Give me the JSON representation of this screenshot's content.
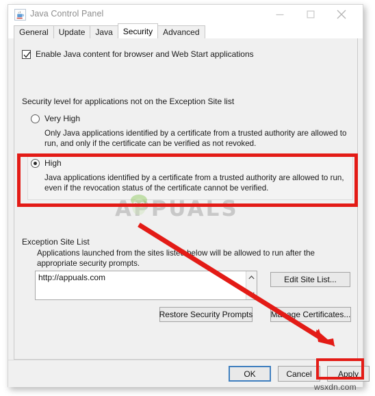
{
  "window": {
    "title": "Java Control Panel",
    "icon": "java-cup-icon",
    "controls": {
      "minimize": "minimize-icon",
      "maximize": "maximize-icon",
      "close": "close-icon"
    }
  },
  "tabs": [
    {
      "label": "General",
      "active": false
    },
    {
      "label": "Update",
      "active": false
    },
    {
      "label": "Java",
      "active": false
    },
    {
      "label": "Security",
      "active": true
    },
    {
      "label": "Advanced",
      "active": false
    }
  ],
  "security": {
    "enable_checkbox": {
      "label": "Enable Java content for browser and Web Start applications",
      "checked": true
    },
    "level_heading": "Security level for applications not on the Exception Site list",
    "levels": [
      {
        "name": "Very High",
        "selected": false,
        "description": "Only Java applications identified by a certificate from a trusted authority are allowed to run, and only if the certificate can be verified as not revoked."
      },
      {
        "name": "High",
        "selected": true,
        "description": "Java applications identified by a certificate from a trusted authority are allowed to run, even if the revocation status of the certificate cannot be verified."
      }
    ],
    "exception_site_list": {
      "heading": "Exception Site List",
      "description": "Applications launched from the sites listed below will be allowed to run after the appropriate security prompts.",
      "entries": [
        "http://appuals.com"
      ],
      "scroll_up_icon": "chevron-up-icon",
      "scroll_down_icon": "chevron-down-icon"
    },
    "buttons": {
      "edit_site_list": "Edit Site List...",
      "restore_security_prompts": "Restore Security Prompts",
      "manage_certificates": "Manage Certificates..."
    }
  },
  "dialog_buttons": {
    "ok": "OK",
    "cancel": "Cancel",
    "apply": "Apply"
  },
  "annotations": {
    "highlight_color": "#e31b16",
    "boxes": [
      "high-security-level",
      "apply-button"
    ],
    "arrow": "red-arrow-pointing-to-apply"
  },
  "watermarks": {
    "appuals": "APPUALS",
    "wsxdn": "wsxdn.com"
  }
}
